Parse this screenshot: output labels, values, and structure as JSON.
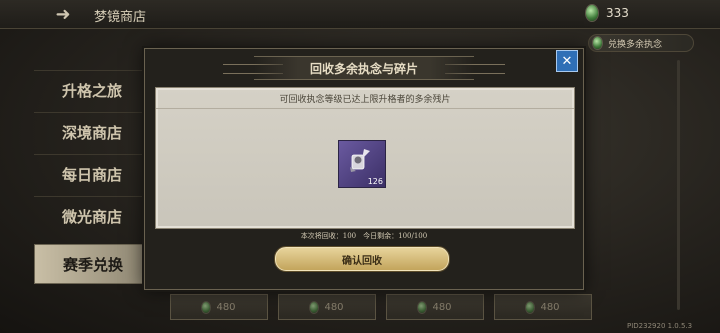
{
  "header": {
    "title": "梦镜商店",
    "currency_value": "333",
    "exchange_label": "兑换多余执念"
  },
  "sidebar": {
    "items": [
      {
        "label": "升格之旅"
      },
      {
        "label": "深境商店"
      },
      {
        "label": "每日商店"
      },
      {
        "label": "微光商店"
      },
      {
        "label": "赛季兑换"
      }
    ],
    "active_index": 4
  },
  "shop_cells": [
    {
      "price": "480"
    },
    {
      "price": "480"
    },
    {
      "price": "480"
    },
    {
      "price": "480"
    }
  ],
  "modal": {
    "title": "回收多余执念与碎片",
    "description": "可回收执念等级已达上限升格者的多余残片",
    "item": {
      "count": "126"
    },
    "recycle_info": "本次将回收：100　今日剩余：100/100",
    "confirm_label": "确认回收"
  },
  "version": "PID232920 1.0.5.3",
  "colors": {
    "accent_gold": "#d8c07e",
    "close_blue": "#2f6fb6",
    "item_purple": "#5a4b92"
  }
}
